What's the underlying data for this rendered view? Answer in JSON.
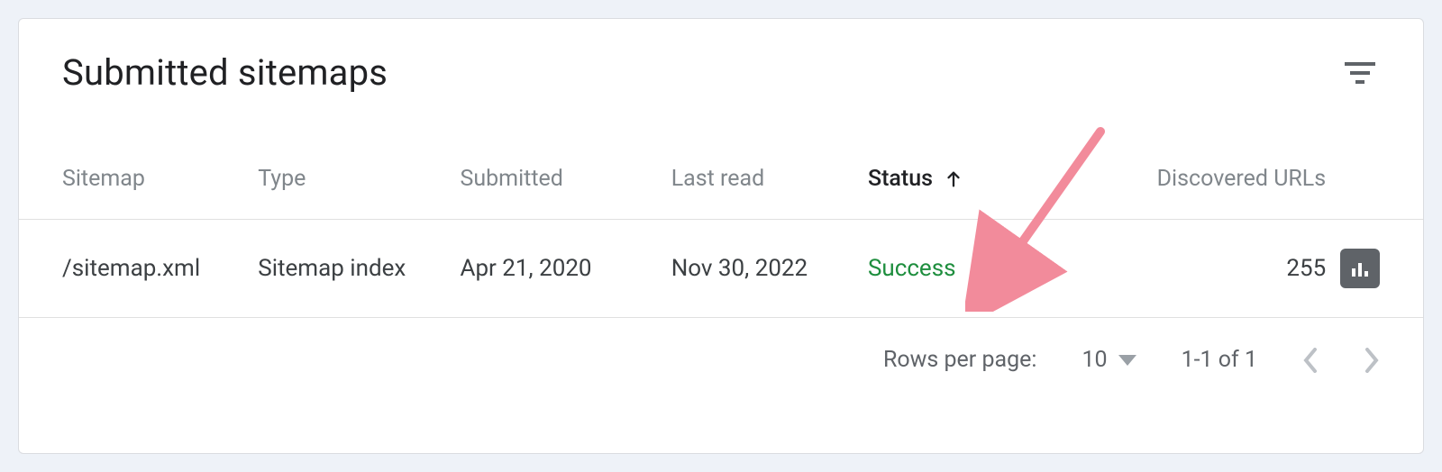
{
  "panel": {
    "title": "Submitted sitemaps"
  },
  "table": {
    "headers": {
      "sitemap": "Sitemap",
      "type": "Type",
      "submitted": "Submitted",
      "last_read": "Last read",
      "status": "Status",
      "discovered_urls": "Discovered URLs"
    },
    "sort": {
      "column": "status",
      "direction": "asc"
    },
    "rows": [
      {
        "sitemap": "/sitemap.xml",
        "type": "Sitemap index",
        "submitted": "Apr 21, 2020",
        "last_read": "Nov 30, 2022",
        "status": "Success",
        "status_color": "#1e8e3e",
        "discovered_urls": "255"
      }
    ]
  },
  "pagination": {
    "rows_per_page_label": "Rows per page:",
    "rows_per_page_value": "10",
    "range_text": "1-1 of 1"
  },
  "icons": {
    "filter": "filter-icon",
    "sort_arrow": "arrow-up-icon",
    "chart": "bar-chart-icon",
    "dropdown": "caret-down-icon",
    "prev": "chevron-left-icon",
    "next": "chevron-right-icon"
  }
}
